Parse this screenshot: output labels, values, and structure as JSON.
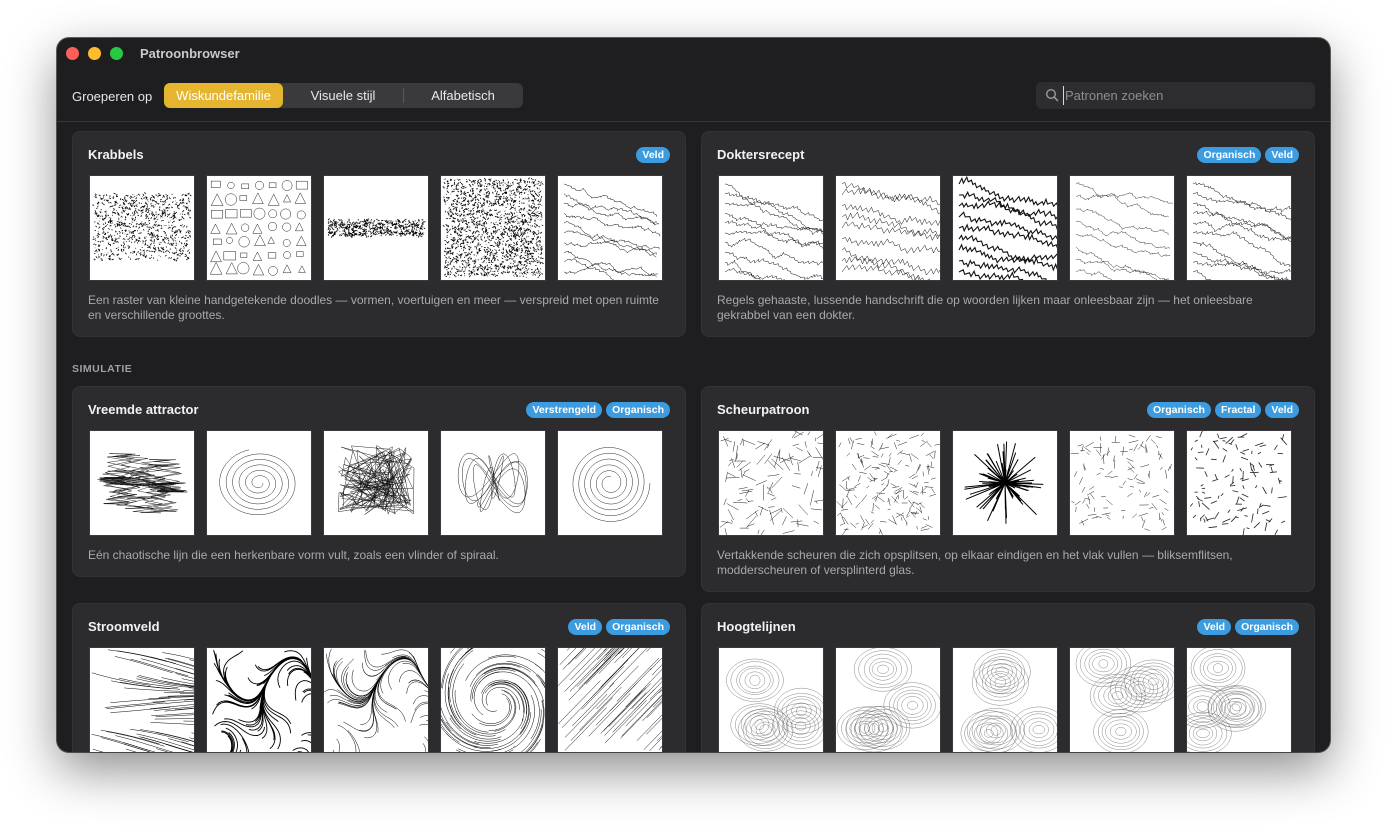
{
  "window": {
    "title": "Patroonbrowser"
  },
  "toolbar": {
    "group_label": "Groeperen op",
    "segments": [
      "Wiskundefamilie",
      "Visuele stijl",
      "Alfabetisch"
    ],
    "active_segment": "Wiskundefamilie",
    "accent_color": "#e6b530"
  },
  "search": {
    "placeholder": "Patronen zoeken",
    "value": "",
    "icon": "search-icon"
  },
  "badge_color": "#3d9be0",
  "sections": [
    {
      "label": ""
    },
    {
      "label": "SIMULATIE"
    }
  ],
  "cards": [
    {
      "title": "Krabbels",
      "tags": [
        "Veld"
      ],
      "description": "Een raster van kleine handgetekende doodles — vormen, voertuigen en meer — verspreid met open ruimte en verschillende groottes."
    },
    {
      "title": "Doktersrecept",
      "tags": [
        "Organisch",
        "Veld"
      ],
      "description": "Regels gehaaste, lussende handschrift die op woorden lijken maar onleesbaar zijn — het onleesbare gekrabbel van een dokter."
    },
    {
      "title": "Vreemde attractor",
      "tags": [
        "Verstrengeld",
        "Organisch"
      ],
      "description": "Eén chaotische lijn die een herkenbare vorm vult, zoals een vlinder of spiraal."
    },
    {
      "title": "Scheurpatroon",
      "tags": [
        "Organisch",
        "Fractal",
        "Veld"
      ],
      "description": "Vertakkende scheuren die zich opsplitsen, op elkaar eindigen en het vlak vullen — bliksemflitsen, modderscheuren of versplinterd glas."
    },
    {
      "title": "Stroomveld",
      "tags": [
        "Veld",
        "Organisch"
      ],
      "description": ""
    },
    {
      "title": "Hoogtelijnen",
      "tags": [
        "Veld",
        "Organisch"
      ],
      "description": ""
    }
  ]
}
